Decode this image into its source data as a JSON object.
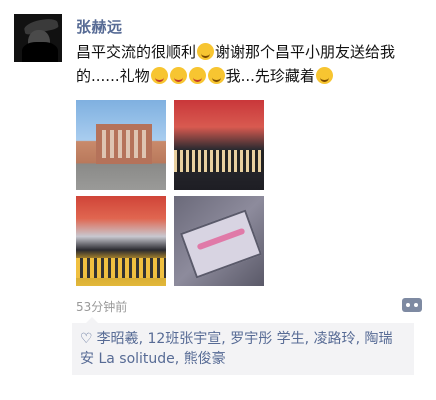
{
  "author": {
    "name": "张赫远"
  },
  "post": {
    "text_part1": "昌平交流的很顺利",
    "text_part2": "谢谢那个昌平小朋友送给我的......礼物",
    "text_part3": "我...先珍藏着",
    "photo_count": 4
  },
  "meta": {
    "time_ago": "53分钟前"
  },
  "likes": {
    "icon": "heart-outline-icon",
    "names": [
      "李昭羲",
      "12班张宇宣",
      "罗宇彤 学生",
      "凌路玲",
      "陶瑞安 La solitude",
      "熊俊豪"
    ],
    "separator": ", "
  },
  "colors": {
    "link": "#576b95",
    "time": "#999999",
    "like_bg": "#f3f3f5"
  }
}
